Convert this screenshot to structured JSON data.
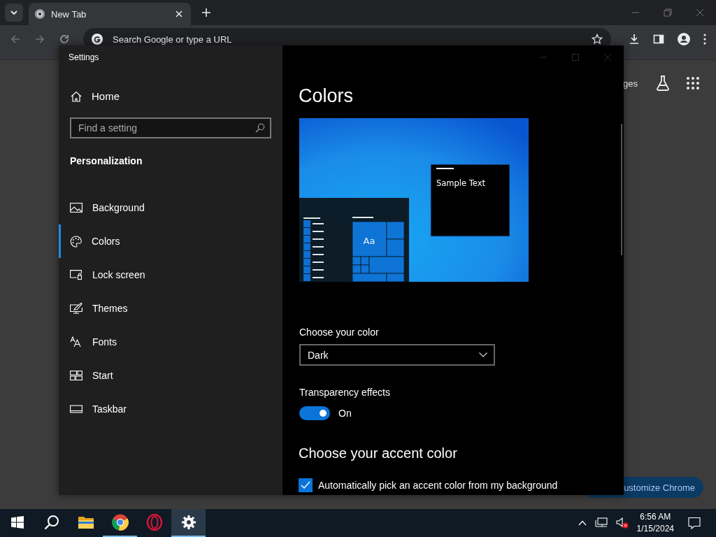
{
  "browser": {
    "tab": {
      "title": "New Tab"
    },
    "omnibox": {
      "placeholder": "Search Google or type a URL"
    },
    "page": {
      "link": "ges",
      "customize_button": "ustomize Chrome"
    }
  },
  "settings_window": {
    "title": "Settings",
    "home": "Home",
    "search": {
      "placeholder": "Find a setting"
    },
    "section": "Personalization",
    "nav": [
      {
        "label": "Background",
        "kind": "background",
        "selected": false
      },
      {
        "label": "Colors",
        "kind": "colors",
        "selected": true
      },
      {
        "label": "Lock screen",
        "kind": "lock",
        "selected": false
      },
      {
        "label": "Themes",
        "kind": "themes",
        "selected": false
      },
      {
        "label": "Fonts",
        "kind": "fonts",
        "selected": false
      },
      {
        "label": "Start",
        "kind": "start",
        "selected": false
      },
      {
        "label": "Taskbar",
        "kind": "taskbar",
        "selected": false
      }
    ],
    "page": {
      "title": "Colors",
      "preview": {
        "sample_text": "Sample Text",
        "tile_text": "Aa"
      },
      "color_mode": {
        "label": "Choose your color",
        "value": "Dark"
      },
      "transparency": {
        "label": "Transparency effects",
        "on": true,
        "state_text": "On"
      },
      "accent": {
        "title": "Choose your accent color",
        "auto_pick": {
          "label": "Automatically pick an accent color from my background",
          "checked": true
        }
      }
    }
  },
  "taskbar": {
    "apps": [
      {
        "kind": "start",
        "running": false,
        "selected": false
      },
      {
        "kind": "search",
        "running": false,
        "selected": false
      },
      {
        "kind": "explorer",
        "running": false,
        "selected": false
      },
      {
        "kind": "chrome",
        "running": true,
        "selected": false
      },
      {
        "kind": "opera",
        "running": false,
        "selected": false
      },
      {
        "kind": "settings",
        "running": true,
        "selected": true
      }
    ],
    "clock": {
      "time": "6:56 AM",
      "date": "1/15/2024"
    }
  }
}
